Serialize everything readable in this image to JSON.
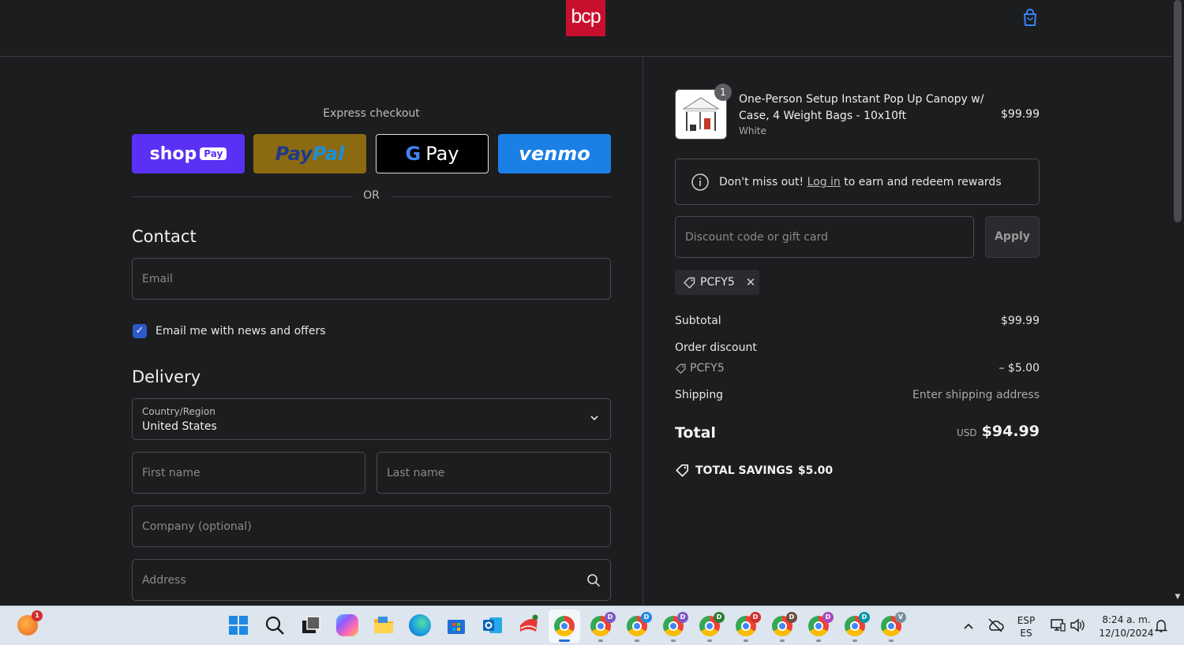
{
  "header": {
    "logo_text": "bcp",
    "cart_icon": "shopping-bag-icon"
  },
  "express": {
    "label": "Express checkout",
    "shop_pay": {
      "text": "shop",
      "badge": "Pay"
    },
    "paypal": {
      "pay": "Pay",
      "pal": "Pal"
    },
    "gpay": {
      "g": "G",
      "text": "Pay"
    },
    "venmo": "venmo",
    "or": "OR"
  },
  "contact": {
    "title": "Contact",
    "email_placeholder": "Email",
    "newsletter_label": "Email me with news and offers",
    "newsletter_checked": true
  },
  "delivery": {
    "title": "Delivery",
    "country_label": "Country/Region",
    "country_value": "United States",
    "first_name_placeholder": "First name",
    "last_name_placeholder": "Last name",
    "company_placeholder": "Company (optional)",
    "address_placeholder": "Address"
  },
  "summary": {
    "product": {
      "quantity": "1",
      "name": "One-Person Setup Instant Pop Up Canopy w/ Case, 4 Weight Bags - 10x10ft",
      "variant": "White",
      "price": "$99.99"
    },
    "rewards": {
      "pre": "Don't miss out!",
      "link": "Log in",
      "post": "to earn and redeem rewards"
    },
    "discount_placeholder": "Discount code or gift card",
    "apply_label": "Apply",
    "applied_code": "PCFY5",
    "subtotal_label": "Subtotal",
    "subtotal_value": "$99.99",
    "order_discount_label": "Order discount",
    "order_discount_code": "PCFY5",
    "order_discount_value": "– $5.00",
    "shipping_label": "Shipping",
    "shipping_value": "Enter shipping address",
    "total_label": "Total",
    "total_currency": "USD",
    "total_value": "$94.99",
    "savings_label": "TOTAL SAVINGS",
    "savings_value": "$5.00"
  },
  "taskbar": {
    "notification_count": "1",
    "chrome_badges": [
      "D",
      "D",
      "D",
      "D",
      "D",
      "D",
      "D",
      "D",
      "V"
    ],
    "lang_top": "ESP",
    "lang_bottom": "ES",
    "time": "8:24 a. m.",
    "date": "12/10/2024"
  },
  "colors": {
    "shop_pay": "#5a31f4",
    "paypal": "#8c6a12",
    "venmo": "#1a80e6",
    "logo": "#c8102e",
    "checkbox": "#2c5ac9"
  }
}
